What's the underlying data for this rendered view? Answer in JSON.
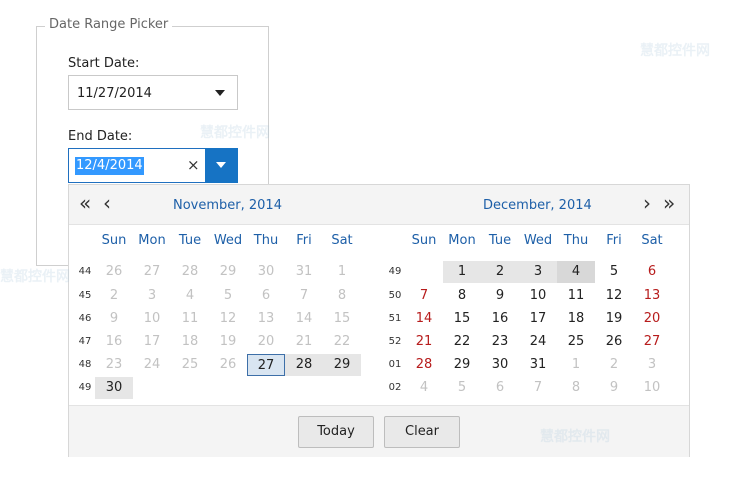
{
  "group": {
    "legend": "Date Range Picker"
  },
  "start": {
    "label": "Start Date:",
    "value": "11/27/2014"
  },
  "end": {
    "label": "End Date:",
    "value": "12/4/2014",
    "clear_icon": "×"
  },
  "nav": {
    "first": "«",
    "prev": "‹",
    "next": "›",
    "last": "»"
  },
  "weekdays": [
    "Sun",
    "Mon",
    "Tue",
    "Wed",
    "Thu",
    "Fri",
    "Sat"
  ],
  "months": [
    {
      "title": "November, 2014",
      "weeks": [
        "44",
        "45",
        "46",
        "47",
        "48",
        "49"
      ],
      "rows": [
        [
          "26",
          "27",
          "28",
          "29",
          "30",
          "31",
          "1"
        ],
        [
          "2",
          "3",
          "4",
          "5",
          "6",
          "7",
          "8"
        ],
        [
          "9",
          "10",
          "11",
          "12",
          "13",
          "14",
          "15"
        ],
        [
          "16",
          "17",
          "18",
          "19",
          "20",
          "21",
          "22"
        ],
        [
          "23",
          "24",
          "25",
          "26",
          "27",
          "28",
          "29"
        ],
        [
          "30"
        ]
      ]
    },
    {
      "title": "December, 2014",
      "weeks": [
        "49",
        "50",
        "51",
        "52",
        "01",
        "02"
      ],
      "rows": [
        [
          "",
          "1",
          "2",
          "3",
          "4",
          "5",
          "6"
        ],
        [
          "7",
          "8",
          "9",
          "10",
          "11",
          "12",
          "13"
        ],
        [
          "14",
          "15",
          "16",
          "17",
          "18",
          "19",
          "20"
        ],
        [
          "21",
          "22",
          "23",
          "24",
          "25",
          "26",
          "27"
        ],
        [
          "28",
          "29",
          "30",
          "31",
          "1",
          "2",
          "3"
        ],
        [
          "4",
          "5",
          "6",
          "7",
          "8",
          "9",
          "10"
        ]
      ]
    }
  ],
  "buttons": {
    "today": "Today",
    "clear": "Clear"
  },
  "watermark": "慧都控件网",
  "colors": {
    "accent": "#1673c4",
    "sunday": "#b71c1c",
    "selection": "#3399ff"
  }
}
